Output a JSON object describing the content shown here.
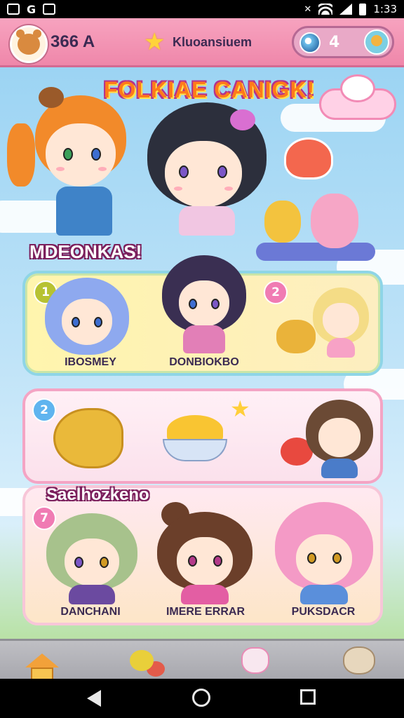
{
  "status_bar": {
    "time": "1:33"
  },
  "header": {
    "coins": "366 A",
    "title": "Kluoansiuem",
    "counter": "4",
    "icons": [
      "bear-avatar-icon",
      "star-icon",
      "moon-orb-icon",
      "mascot-icon"
    ]
  },
  "scene": {
    "game_title": "FOLKIAE CANIGK!",
    "section_1_label": "MDEONKAS!",
    "section_3_label": "Saelhozkeno"
  },
  "panels": [
    {
      "badge": "1",
      "badge2": "2",
      "labels": [
        "IBOSMEY",
        "DONBIOKBO"
      ]
    },
    {
      "badge": "2"
    },
    {
      "badge": "7",
      "labels": [
        "DANCHANI",
        "IMERE ERRAR",
        "PUKSDACR"
      ]
    }
  ],
  "nav": {
    "items": [
      "home-icon",
      "fruit-icon",
      "bunny-icon",
      "cookie-icon"
    ]
  },
  "colors": {
    "header_pink": "#ef87aa",
    "title_orange": "#ff7a1a",
    "panel_blue_border": "#8ed5e6",
    "panel_pink_border": "#f4a4c4"
  }
}
